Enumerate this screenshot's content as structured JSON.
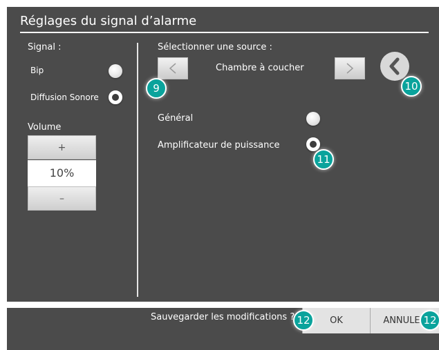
{
  "title": "Réglages du signal d’alarme",
  "signal": {
    "label": "Signal :",
    "options": [
      {
        "label": "Bip",
        "selected": false
      },
      {
        "label": "Diffusion Sonore",
        "selected": true
      }
    ]
  },
  "volume": {
    "label": "Volume",
    "plus": "+",
    "value": "10%",
    "minus": "–"
  },
  "source": {
    "label": "Sélectionner une source :",
    "current": "Chambre à coucher",
    "prev_icon": "chevron-left-icon",
    "next_icon": "chevron-right-icon",
    "back_icon": "back-arrow-icon",
    "options": [
      {
        "label": "Général",
        "selected": false
      },
      {
        "label": "Amplificateur de puissance",
        "selected": true
      }
    ]
  },
  "badges": {
    "b9": "9",
    "b10": "10",
    "b11": "11",
    "b12a": "12",
    "b12b": "12"
  },
  "footer": {
    "question": "Sauvegarder les modifications ?",
    "ok": "OK",
    "cancel": "ANNULER"
  },
  "colors": {
    "panel": "#4b4b4b",
    "badge": "#0aa39c"
  }
}
